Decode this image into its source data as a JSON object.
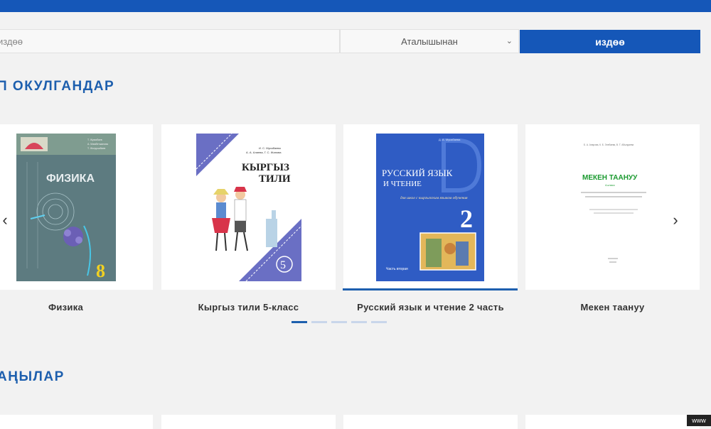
{
  "search": {
    "placeholder": "издөө",
    "select_value": "Аталышынан",
    "button_label": "издөө"
  },
  "sections": {
    "popular_title": "П ОКУЛГАНДАР",
    "new_title": "АҢЫЛАР"
  },
  "books": [
    {
      "title": "Физика",
      "cover_title": "ФИЗИКА",
      "cover_number": "8",
      "cover_authors": [
        "Т. Жумабаев",
        "А. Мамбетжанова",
        "Т. Жолдошбаев"
      ]
    },
    {
      "title": "Кыргыз тили 5-класс",
      "cover_title_line1": "КЫРГЫЗ",
      "cover_title_line2": "ТИЛИ",
      "cover_number": "5",
      "cover_authors": [
        "И. С. Мусабаева",
        "А. А. Алиева, Г. С. Жапова"
      ]
    },
    {
      "title": "Русский язык и чтение 2 часть",
      "cover_title_line1": "РУССКИЙ ЯЗЫК",
      "cover_title_line2": "И ЧТЕНИЕ",
      "cover_subtitle": "для школ с кыргызским языком обучения",
      "cover_number": "2",
      "cover_part": "Часть вторая",
      "cover_author": "Д. А. Мусабаева"
    },
    {
      "title": "Мекен таануу",
      "cover_title": "МЕКЕН ТААНУУ",
      "cover_grade": "4-класс",
      "cover_authors": "Б. А. Анарова, К. Б. Элебаева, В. Т. Абылдаева"
    }
  ],
  "carousel": {
    "active_index": 2,
    "page_count": 5,
    "active_page": 0
  },
  "footer_badge": "www",
  "colors": {
    "brand": "#1557b8",
    "heading": "#1d5fae",
    "background": "#f2f2f2",
    "physics_cover": "#5d7b80",
    "kyrgyz_cover_accent": "#6a6fc4",
    "russian_cover": "#2f5cc4",
    "meken_title": "#1a9a2f"
  },
  "icons": {
    "prev": "chevron-left-icon",
    "next": "chevron-right-icon",
    "select": "chevron-down-icon"
  }
}
